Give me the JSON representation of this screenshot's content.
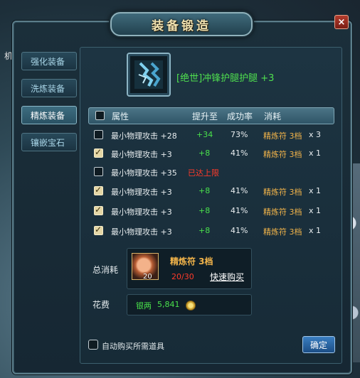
{
  "background": {
    "side_text": "机"
  },
  "window": {
    "title": "装备锻造",
    "close": "×"
  },
  "sidebar": {
    "tabs": [
      {
        "label": "强化装备",
        "active": false
      },
      {
        "label": "洗炼装备",
        "active": false
      },
      {
        "label": "精炼装备",
        "active": true
      },
      {
        "label": "镶嵌宝石",
        "active": false
      }
    ]
  },
  "item": {
    "name": "[绝世]冲锋护腿护腿 +3",
    "icon": "leg-armor-icon"
  },
  "table": {
    "headers": {
      "attr": "属性",
      "upgrade": "提升至",
      "rate": "成功率",
      "cost": "消耗"
    },
    "rows": [
      {
        "checked": false,
        "attr": "最小物理攻击 +28",
        "upgrade": "+34",
        "rate": "73%",
        "cost_item": "精炼符 3档",
        "cost_qty": "x 3",
        "maxed": false
      },
      {
        "checked": true,
        "attr": "最小物理攻击 +3",
        "upgrade": "+8",
        "rate": "41%",
        "cost_item": "精炼符 3档",
        "cost_qty": "x 1",
        "maxed": false
      },
      {
        "checked": false,
        "attr": "最小物理攻击 +35",
        "upgrade": "已达上限",
        "rate": "",
        "cost_item": "",
        "cost_qty": "",
        "maxed": true
      },
      {
        "checked": true,
        "attr": "最小物理攻击 +3",
        "upgrade": "+8",
        "rate": "41%",
        "cost_item": "精炼符 3档",
        "cost_qty": "x 1",
        "maxed": false
      },
      {
        "checked": true,
        "attr": "最小物理攻击 +3",
        "upgrade": "+8",
        "rate": "41%",
        "cost_item": "精炼符 3档",
        "cost_qty": "x 1",
        "maxed": false
      },
      {
        "checked": true,
        "attr": "最小物理攻击 +3",
        "upgrade": "+8",
        "rate": "41%",
        "cost_item": "精炼符 3档",
        "cost_qty": "x 1",
        "maxed": false
      }
    ]
  },
  "summary": {
    "total_label": "总消耗",
    "stone_name": "精炼符 3档",
    "stone_count": "20",
    "stone_progress": "20/30",
    "quick_buy": "快速购买",
    "fee_label": "花费",
    "silver_label": "银两",
    "silver_value": "5,841"
  },
  "footer": {
    "auto_buy_label": "自动购买所需道具",
    "auto_buy_checked": false,
    "confirm": "确定"
  }
}
